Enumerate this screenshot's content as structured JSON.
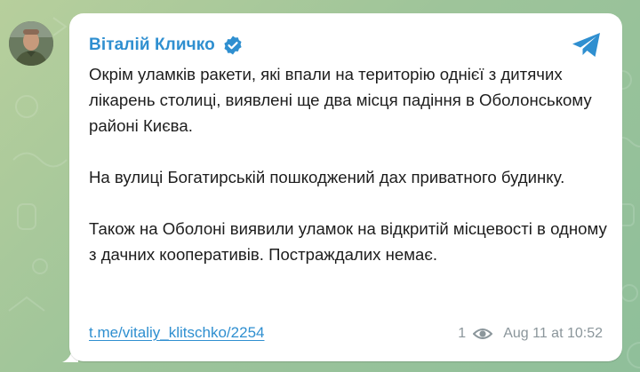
{
  "post": {
    "author": "Віталій Кличко",
    "verified_icon": "verified-badge-icon",
    "share_icon": "telegram-plane-icon",
    "paragraphs": [
      "Окрім уламків ракети, які впали на територію однієї з дитячих лікарень столиці, виявлені ще два місця падіння в Оболонському районі Києва.",
      "На вулиці Богатирській пошкоджений дах приватного будинку.",
      "Також на Оболоні виявили уламок на відкритій місцевості в одному з дачних кооперативів. Постраждалих немає."
    ],
    "link": "t.me/vitaliy_klitschko/2254",
    "views": "1",
    "timestamp": "Aug 11 at 10:52"
  },
  "colors": {
    "accent": "#2f8fd0",
    "background": "#a7c49a",
    "meta": "#8b969b"
  }
}
